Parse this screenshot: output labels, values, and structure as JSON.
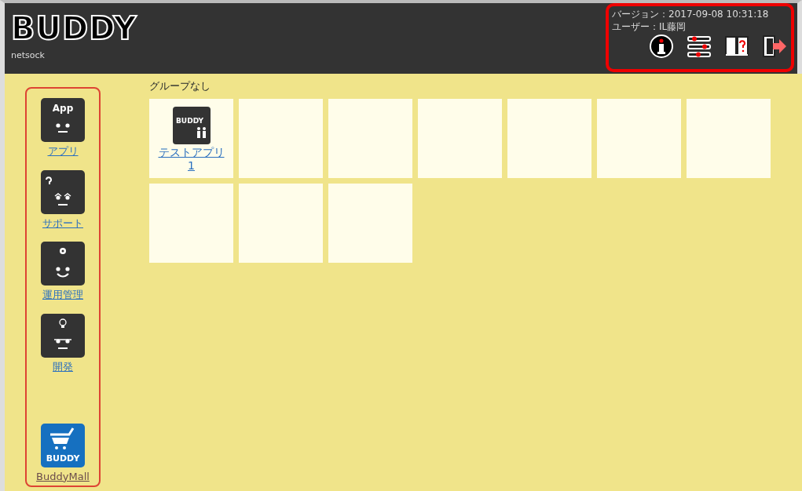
{
  "header": {
    "logo": "BUDDY",
    "company": "netsock",
    "version": "バージョン：2017-09-08 10:31:18",
    "user": "ユーザー：IL藤岡",
    "tools": [
      {
        "kind": "info"
      },
      {
        "kind": "settings"
      },
      {
        "kind": "manual"
      },
      {
        "kind": "logout"
      }
    ]
  },
  "sidebar": {
    "items": [
      {
        "kind": "app",
        "icon_text": "App",
        "label": "アプリ"
      },
      {
        "kind": "support",
        "label": "サポート"
      },
      {
        "kind": "admin",
        "label": "運用管理"
      },
      {
        "kind": "dev",
        "label": "開発"
      },
      {
        "kind": "mall",
        "icon_text": "BUDDY",
        "label": "BuddyMall"
      }
    ]
  },
  "group": {
    "title": "グループなし",
    "tiles": [
      {
        "kind": "app",
        "icon_text": "BUDDY",
        "label": "テストアプリ1"
      },
      {
        "kind": "empty"
      },
      {
        "kind": "empty"
      },
      {
        "kind": "empty"
      },
      {
        "kind": "empty"
      },
      {
        "kind": "empty"
      },
      {
        "kind": "empty"
      },
      {
        "kind": "empty"
      },
      {
        "kind": "empty"
      },
      {
        "kind": "empty"
      }
    ]
  }
}
